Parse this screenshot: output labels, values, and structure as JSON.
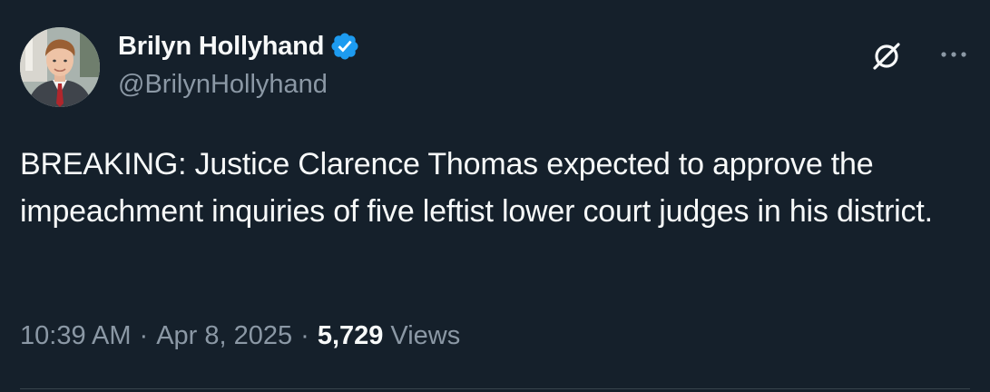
{
  "author": {
    "display_name": "Brilyn Hollyhand",
    "handle": "@BrilynHollyhand",
    "verified": true,
    "avatar_icon": "profile-photo"
  },
  "actions": {
    "grok_icon": "grok-icon",
    "more_icon": "more-dots-icon"
  },
  "tweet": {
    "text": "BREAKING: Justice Clarence Thomas expected to approve the impeachment inquiries of five leftist lower court judges in his district."
  },
  "meta": {
    "time": "10:39 AM",
    "separator": "·",
    "date": "Apr 8, 2025",
    "views_count": "5,729",
    "views_label": "Views"
  },
  "colors": {
    "background": "#15202b",
    "primary_text": "#f7f9f9",
    "secondary_text": "#8b98a5",
    "verified_blue": "#1d9bf0",
    "divider": "#38444d"
  }
}
